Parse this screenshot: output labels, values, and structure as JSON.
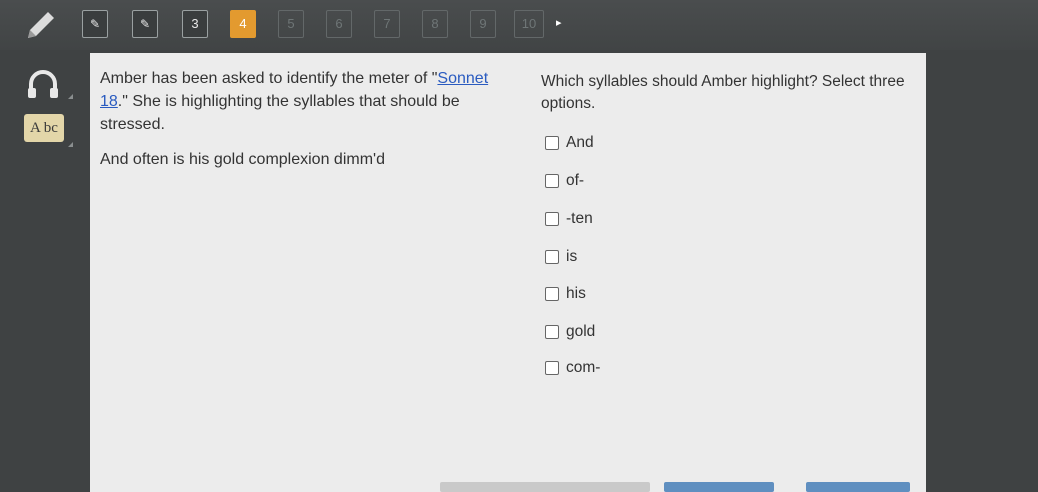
{
  "toolbar": {
    "question_nav": [
      "",
      "",
      "3",
      "4",
      "5",
      "6",
      "7",
      "8",
      "9",
      "10"
    ],
    "current_index": 4,
    "accent_color": "#e39a2f"
  },
  "icons": {
    "pencil": "pencil-icon",
    "headphones": "headphones-icon",
    "abc": "abc-icon",
    "abc_text": "A bc",
    "next": "next-arrow-icon",
    "next_glyph": "▸"
  },
  "passage": {
    "intro_before": "Amber has been asked to identify the meter of \"",
    "link_text": "Sonnet 18",
    "intro_after": ".\" She is highlighting the syllables that should be stressed.",
    "line": "And often is his gold complexion dimm'd"
  },
  "question": {
    "prompt": "Which syllables should Amber highlight? Select three options.",
    "options": [
      "And",
      "of-",
      "-ten",
      "is",
      "his",
      "gold",
      "com-"
    ]
  }
}
